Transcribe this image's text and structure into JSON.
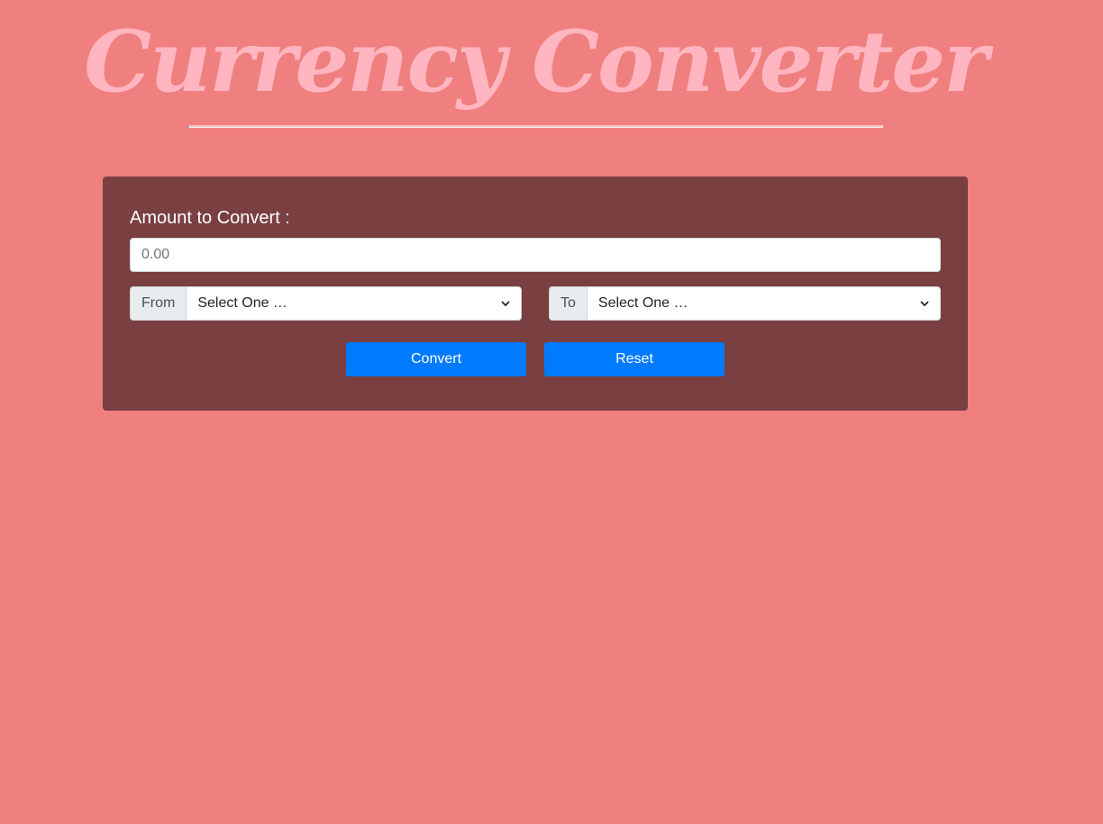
{
  "header": {
    "title": "Currency Converter"
  },
  "form": {
    "amount_label": "Amount to Convert :",
    "amount_placeholder": "0.00",
    "from_label": "From",
    "from_selected": "Select One …",
    "to_label": "To",
    "to_selected": "Select One …",
    "convert_label": "Convert",
    "reset_label": "Reset"
  },
  "icons": {
    "select_arrow": "chevron-down-icon"
  },
  "colors": {
    "background": "#f08080",
    "title": "#ffb6c1",
    "card": "#793f41",
    "button": "#007bff"
  }
}
